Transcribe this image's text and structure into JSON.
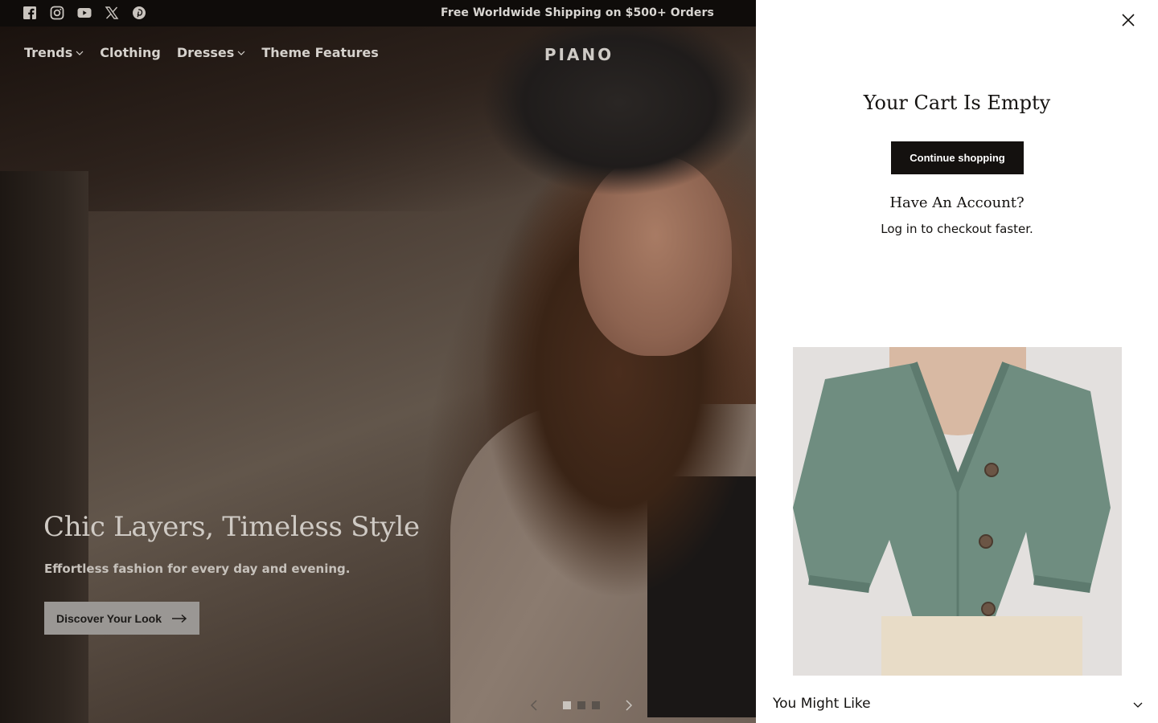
{
  "announcement": {
    "text": "Free Worldwide Shipping on $500+ Orders",
    "socials": [
      "facebook-icon",
      "instagram-icon",
      "youtube-icon",
      "x-icon",
      "pinterest-icon"
    ]
  },
  "nav": {
    "items": [
      {
        "label": "Trends",
        "has_dropdown": true
      },
      {
        "label": "Clothing",
        "has_dropdown": false
      },
      {
        "label": "Dresses",
        "has_dropdown": true
      },
      {
        "label": "Theme Features",
        "has_dropdown": false
      }
    ],
    "logo": "PIANO"
  },
  "hero": {
    "title": "Chic Layers, Timeless Style",
    "subtitle": "Effortless fashion for every day and evening.",
    "cta": "Discover Your Look",
    "slides_total": 3,
    "active_slide": 1
  },
  "cart": {
    "title": "Your Cart Is Empty",
    "continue_label": "Continue shopping",
    "account_title": "Have An Account?",
    "login_link": "Log in",
    "login_suffix": " to checkout faster.",
    "you_might_like": "You Might Like"
  },
  "colors": {
    "announcement_bg": "#0f0c0a",
    "drawer_bg": "#ffffff",
    "primary_button": "#14110f",
    "cardigan": "#6f8d80"
  }
}
